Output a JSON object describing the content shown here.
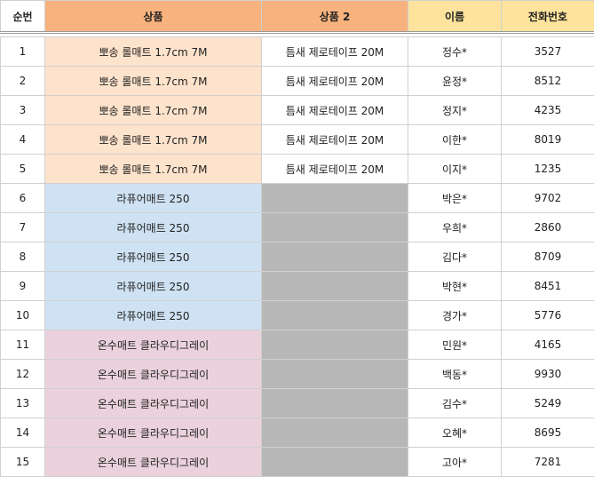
{
  "headers": {
    "seq": "순번",
    "product": "상품",
    "product2": "상품 2",
    "name": "이름",
    "phone": "전화번호"
  },
  "colors": {
    "header_orange": "#f7b27e",
    "header_yellow": "#fde39b",
    "row_orange": "#fde3cc",
    "row_blue": "#cfe2f3",
    "row_pink": "#ead1dc",
    "empty_gray": "#b7b7b7"
  },
  "rows": [
    {
      "seq": "1",
      "product": "뽀송 롤매트 1.7cm 7M",
      "product2": "틈새 제로테이프 20M",
      "name": "정수*",
      "phone": "3527",
      "tone": "orange"
    },
    {
      "seq": "2",
      "product": "뽀송 롤매트 1.7cm 7M",
      "product2": "틈새 제로테이프 20M",
      "name": "윤정*",
      "phone": "8512",
      "tone": "orange"
    },
    {
      "seq": "3",
      "product": "뽀송 롤매트 1.7cm 7M",
      "product2": "틈새 제로테이프 20M",
      "name": "정지*",
      "phone": "4235",
      "tone": "orange"
    },
    {
      "seq": "4",
      "product": "뽀송 롤매트 1.7cm 7M",
      "product2": "틈새 제로테이프 20M",
      "name": "이한*",
      "phone": "8019",
      "tone": "orange"
    },
    {
      "seq": "5",
      "product": "뽀송 롤매트 1.7cm 7M",
      "product2": "틈새 제로테이프 20M",
      "name": "이지*",
      "phone": "1235",
      "tone": "orange"
    },
    {
      "seq": "6",
      "product": "라퓨어매트 250",
      "product2": "",
      "name": "박은*",
      "phone": "9702",
      "tone": "blue"
    },
    {
      "seq": "7",
      "product": "라퓨어매트 250",
      "product2": "",
      "name": "우희*",
      "phone": "2860",
      "tone": "blue"
    },
    {
      "seq": "8",
      "product": "라퓨어매트 250",
      "product2": "",
      "name": "김다*",
      "phone": "8709",
      "tone": "blue"
    },
    {
      "seq": "9",
      "product": "라퓨어매트 250",
      "product2": "",
      "name": "박현*",
      "phone": "8451",
      "tone": "blue"
    },
    {
      "seq": "10",
      "product": "라퓨어매트 250",
      "product2": "",
      "name": "경가*",
      "phone": "5776",
      "tone": "blue"
    },
    {
      "seq": "11",
      "product": "온수매트 클라우디그레이",
      "product2": "",
      "name": "민원*",
      "phone": "4165",
      "tone": "pink"
    },
    {
      "seq": "12",
      "product": "온수매트 클라우디그레이",
      "product2": "",
      "name": "백동*",
      "phone": "9930",
      "tone": "pink"
    },
    {
      "seq": "13",
      "product": "온수매트 클라우디그레이",
      "product2": "",
      "name": "김수*",
      "phone": "5249",
      "tone": "pink"
    },
    {
      "seq": "14",
      "product": "온수매트 클라우디그레이",
      "product2": "",
      "name": "오혜*",
      "phone": "8695",
      "tone": "pink"
    },
    {
      "seq": "15",
      "product": "온수매트 클라우디그레이",
      "product2": "",
      "name": "고아*",
      "phone": "7281",
      "tone": "pink"
    }
  ]
}
